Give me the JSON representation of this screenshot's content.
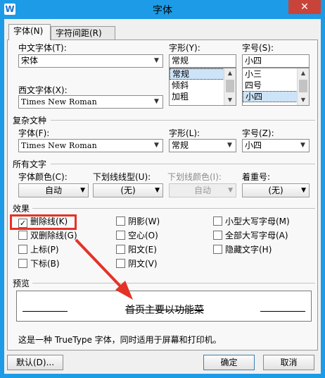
{
  "window": {
    "title": "字体",
    "app_icon_letter": "W",
    "close_glyph": "✕"
  },
  "tabs": [
    {
      "label": "字体(N)"
    },
    {
      "label": "字符间距(R)"
    }
  ],
  "chinese_font": {
    "label": "中文字体(T):",
    "value": "宋体"
  },
  "style": {
    "label": "字形(Y):",
    "value": "常规",
    "options": [
      "常规",
      "倾斜",
      "加粗"
    ],
    "selected": "常规"
  },
  "size": {
    "label": "字号(S):",
    "value": "小四",
    "options": [
      "小三",
      "四号",
      "小四"
    ],
    "selected": "小四"
  },
  "western_font": {
    "label": "西文字体(X):",
    "value": "Times New Roman"
  },
  "complex": {
    "title": "复杂文种",
    "font_label": "字体(F):",
    "font_value": "Times New Roman",
    "style_label": "字形(L):",
    "style_value": "常规",
    "size_label": "字号(Z):",
    "size_value": "小四"
  },
  "all_text": {
    "title": "所有文字",
    "color_label": "字体颜色(C):",
    "color_value": "自动",
    "underline_label": "下划线线型(U):",
    "underline_value": "(无)",
    "underline_color_label": "下划线颜色(I):",
    "underline_color_value": "自动",
    "emphasis_label": "着重号:",
    "emphasis_value": "(无)"
  },
  "effects": {
    "title": "效果",
    "items": [
      {
        "label": "删除线(K)",
        "checked": true
      },
      {
        "label": "双删除线(G)",
        "checked": false
      },
      {
        "label": "上标(P)",
        "checked": false
      },
      {
        "label": "下标(B)",
        "checked": false
      },
      {
        "label": "阴影(W)",
        "checked": false
      },
      {
        "label": "空心(O)",
        "checked": false
      },
      {
        "label": "阳文(E)",
        "checked": false
      },
      {
        "label": "阴文(V)",
        "checked": false
      },
      {
        "label": "小型大写字母(M)",
        "checked": false
      },
      {
        "label": "全部大写字母(A)",
        "checked": false
      },
      {
        "label": "隐藏文字(H)",
        "checked": false
      }
    ]
  },
  "preview": {
    "title": "预览",
    "sample_text": "首页主要以功能菜",
    "note": "这是一种 TrueType 字体，同时适用于屏幕和打印机。"
  },
  "buttons": {
    "default": "默认(D)...",
    "ok": "确定",
    "cancel": "取消"
  },
  "annotation": {
    "highlight_color": "#e53227"
  }
}
